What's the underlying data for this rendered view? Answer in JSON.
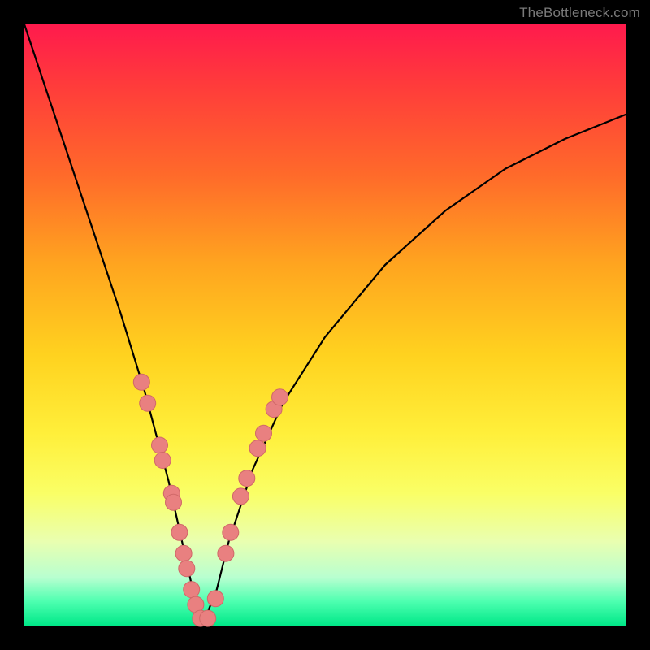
{
  "watermark": "TheBottleneck.com",
  "colors": {
    "dot_fill": "#e98080",
    "dot_stroke": "#d06868",
    "curve": "#000000",
    "frame_bg_top": "#ff1a4d",
    "frame_bg_bottom": "#00e888",
    "page_bg": "#000000"
  },
  "chart_data": {
    "type": "line",
    "title": "",
    "xlabel": "",
    "ylabel": "",
    "xlim": [
      0,
      1
    ],
    "ylim": [
      0,
      1
    ],
    "note": "Axes unlabeled; V-shaped curve with minimum near x≈0.29. Values are fractional positions (0..1) read from pixel geometry; y=1 is top, y=0 is bottom.",
    "series": [
      {
        "name": "curve",
        "x": [
          0.0,
          0.04,
          0.08,
          0.12,
          0.16,
          0.2,
          0.24,
          0.26,
          0.28,
          0.3,
          0.32,
          0.34,
          0.38,
          0.43,
          0.5,
          0.6,
          0.7,
          0.8,
          0.9,
          1.0
        ],
        "y": [
          1.0,
          0.88,
          0.76,
          0.64,
          0.52,
          0.39,
          0.24,
          0.15,
          0.06,
          0.01,
          0.06,
          0.14,
          0.26,
          0.37,
          0.48,
          0.6,
          0.69,
          0.76,
          0.81,
          0.85
        ]
      }
    ],
    "points": {
      "name": "highlighted-dots",
      "xy": [
        [
          0.195,
          0.405
        ],
        [
          0.205,
          0.37
        ],
        [
          0.225,
          0.3
        ],
        [
          0.23,
          0.275
        ],
        [
          0.245,
          0.22
        ],
        [
          0.248,
          0.205
        ],
        [
          0.258,
          0.155
        ],
        [
          0.265,
          0.12
        ],
        [
          0.27,
          0.095
        ],
        [
          0.278,
          0.06
        ],
        [
          0.285,
          0.035
        ],
        [
          0.293,
          0.012
        ],
        [
          0.305,
          0.012
        ],
        [
          0.318,
          0.045
        ],
        [
          0.335,
          0.12
        ],
        [
          0.343,
          0.155
        ],
        [
          0.36,
          0.215
        ],
        [
          0.37,
          0.245
        ],
        [
          0.388,
          0.295
        ],
        [
          0.398,
          0.32
        ],
        [
          0.415,
          0.36
        ],
        [
          0.425,
          0.38
        ]
      ]
    }
  }
}
